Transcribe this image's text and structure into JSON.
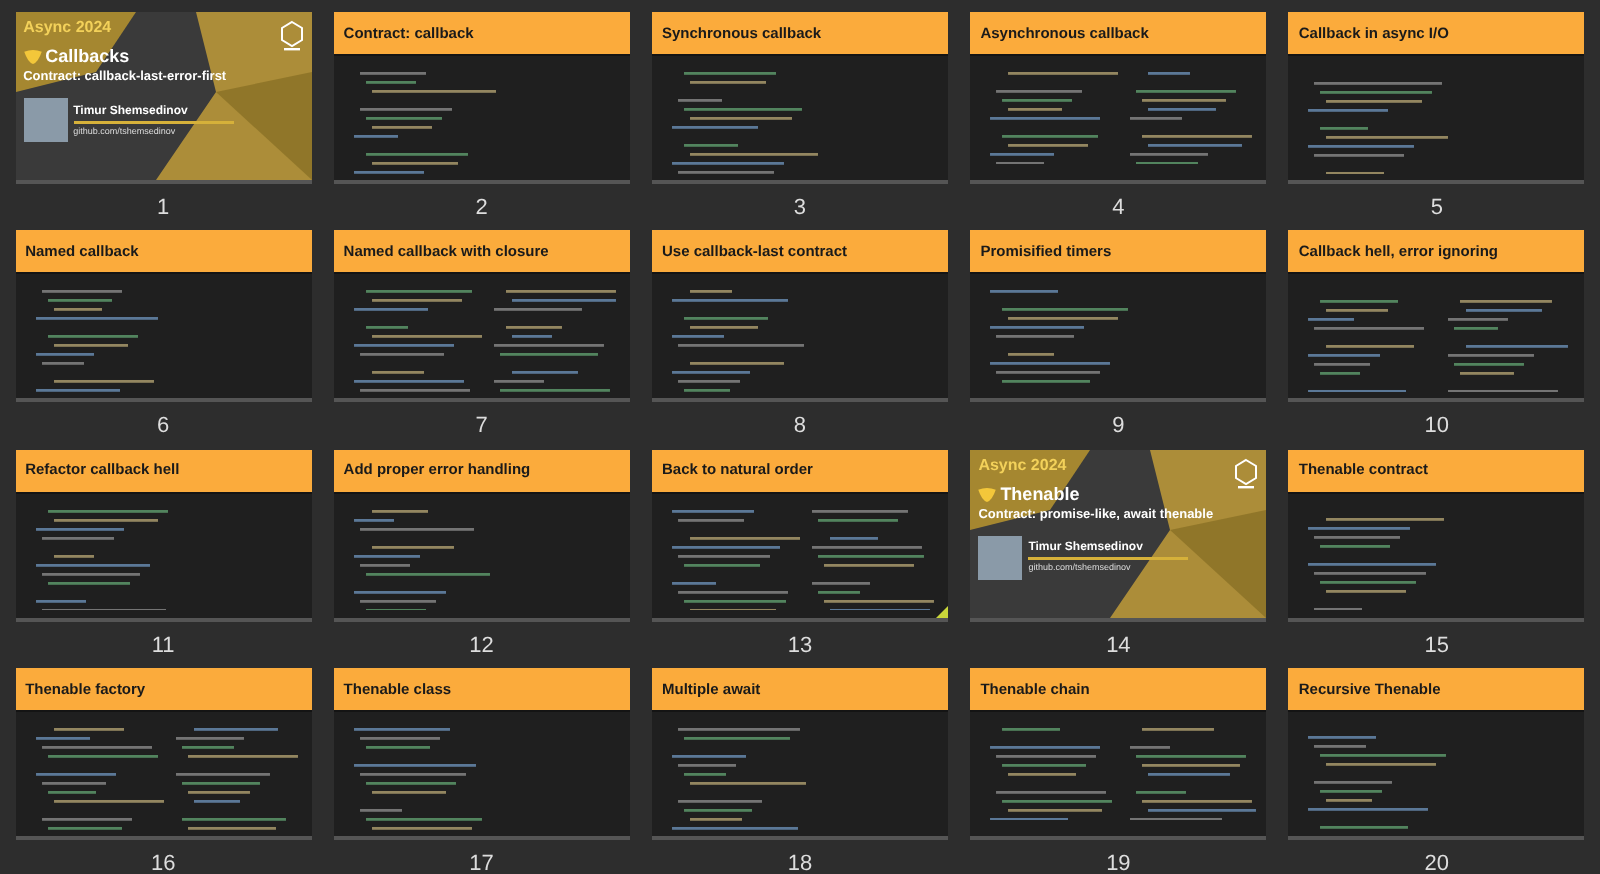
{
  "slides": [
    {
      "kind": "title",
      "number": "1",
      "event": "Async 2024",
      "title": "Callbacks",
      "subtitle": "Contract: callback-last-error-first",
      "author": "Timur Shemsedinov",
      "link": "github.com/tshemsedinov",
      "flagged": false
    },
    {
      "kind": "code",
      "number": "2",
      "title": "Contract: callback",
      "flagged": false
    },
    {
      "kind": "code",
      "number": "3",
      "title": "Synchronous callback",
      "flagged": false
    },
    {
      "kind": "code",
      "number": "4",
      "title": "Asynchronous callback",
      "flagged": false
    },
    {
      "kind": "code",
      "number": "5",
      "title": "Callback in async I/O",
      "flagged": false
    },
    {
      "kind": "code",
      "number": "6",
      "title": "Named callback",
      "flagged": false
    },
    {
      "kind": "code",
      "number": "7",
      "title": "Named callback with closure",
      "flagged": false
    },
    {
      "kind": "code",
      "number": "8",
      "title": "Use callback-last contract",
      "flagged": false
    },
    {
      "kind": "code",
      "number": "9",
      "title": "Promisified timers",
      "flagged": false
    },
    {
      "kind": "code",
      "number": "10",
      "title": "Callback hell, error ignoring",
      "flagged": false
    },
    {
      "kind": "code",
      "number": "11",
      "title": "Refactor callback hell",
      "flagged": false
    },
    {
      "kind": "code",
      "number": "12",
      "title": "Add proper error handling",
      "flagged": false
    },
    {
      "kind": "code",
      "number": "13",
      "title": "Back to natural order",
      "flagged": true
    },
    {
      "kind": "title",
      "number": "14",
      "event": "Async 2024",
      "title": "Thenable",
      "subtitle": "Contract: promise-like, await thenable",
      "author": "Timur Shemsedinov",
      "link": "github.com/tshemsedinov",
      "flagged": false
    },
    {
      "kind": "code",
      "number": "15",
      "title": "Thenable contract",
      "flagged": false
    },
    {
      "kind": "code",
      "number": "16",
      "title": "Thenable factory",
      "flagged": false
    },
    {
      "kind": "code",
      "number": "17",
      "title": "Thenable class",
      "flagged": false
    },
    {
      "kind": "code",
      "number": "18",
      "title": "Multiple await",
      "flagged": false
    },
    {
      "kind": "code",
      "number": "19",
      "title": "Thenable chain",
      "flagged": false
    },
    {
      "kind": "code",
      "number": "20",
      "title": "Recursive Thenable",
      "flagged": false
    }
  ]
}
